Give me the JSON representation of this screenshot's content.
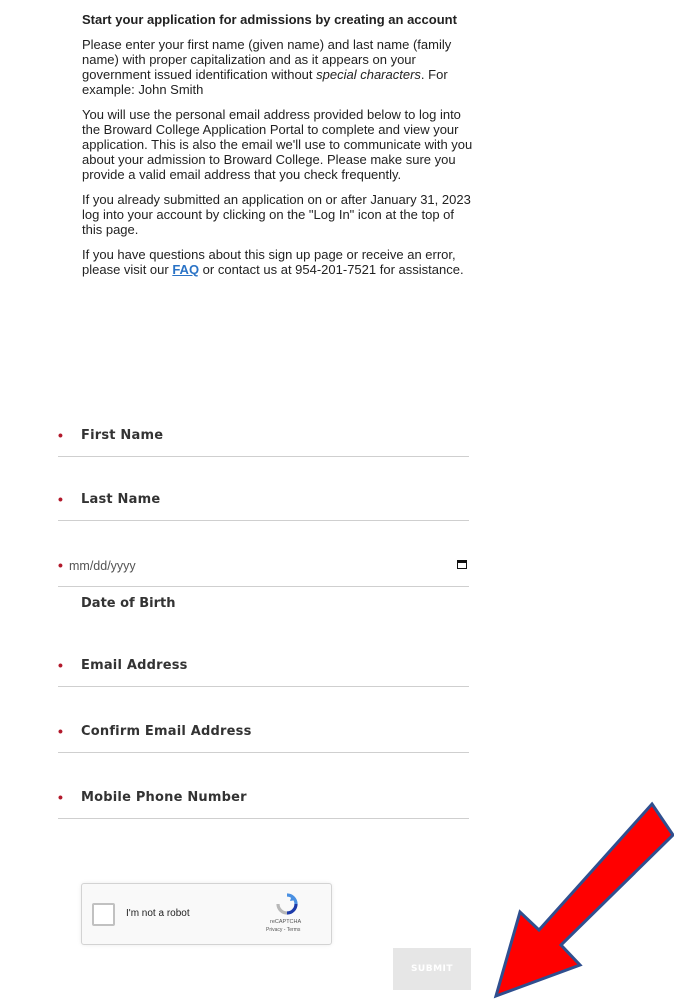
{
  "intro": {
    "heading": "Start your application for admissions by creating an account",
    "p1": "Please enter your first name (given name) and last name (family name) with proper capitalization and as it appears on your government issued identification without ",
    "p1_em": "special characters",
    "p1_end": ". For example: John Smith",
    "p2": "You will use the personal email address provided below to log into the Broward College Application Portal to complete and view your application. This is also the email we'll use to communicate with you about your admission to Broward College. Please make sure you provide a valid email address that you check frequently.",
    "p3": "If you already submitted an application on or after January 31, 2023 log into your account by clicking on the \"Log In\" icon at the top of this page.",
    "p4_start": "If you have questions about this sign up page or receive an error, please visit our ",
    "p4_link": "FAQ",
    "p4_end": " or contact us at 954-201-7521 for assistance."
  },
  "form": {
    "required_mark": "•",
    "first_name": "First Name",
    "last_name": "Last Name",
    "dob_placeholder": "mm/dd/yyyy",
    "dob_label": "Date of Birth",
    "email": "Email Address",
    "confirm_email": "Confirm Email Address",
    "mobile": "Mobile Phone Number"
  },
  "recaptcha": {
    "label": "I'm not a robot",
    "brand": "reCAPTCHA",
    "privacy": "Privacy - Terms"
  },
  "submit_label": "SUBMIT",
  "colors": {
    "required": "#b2192b",
    "link": "#2a73c6",
    "arrow": "#ff0000",
    "arrow_outline": "#2f4f8f"
  }
}
